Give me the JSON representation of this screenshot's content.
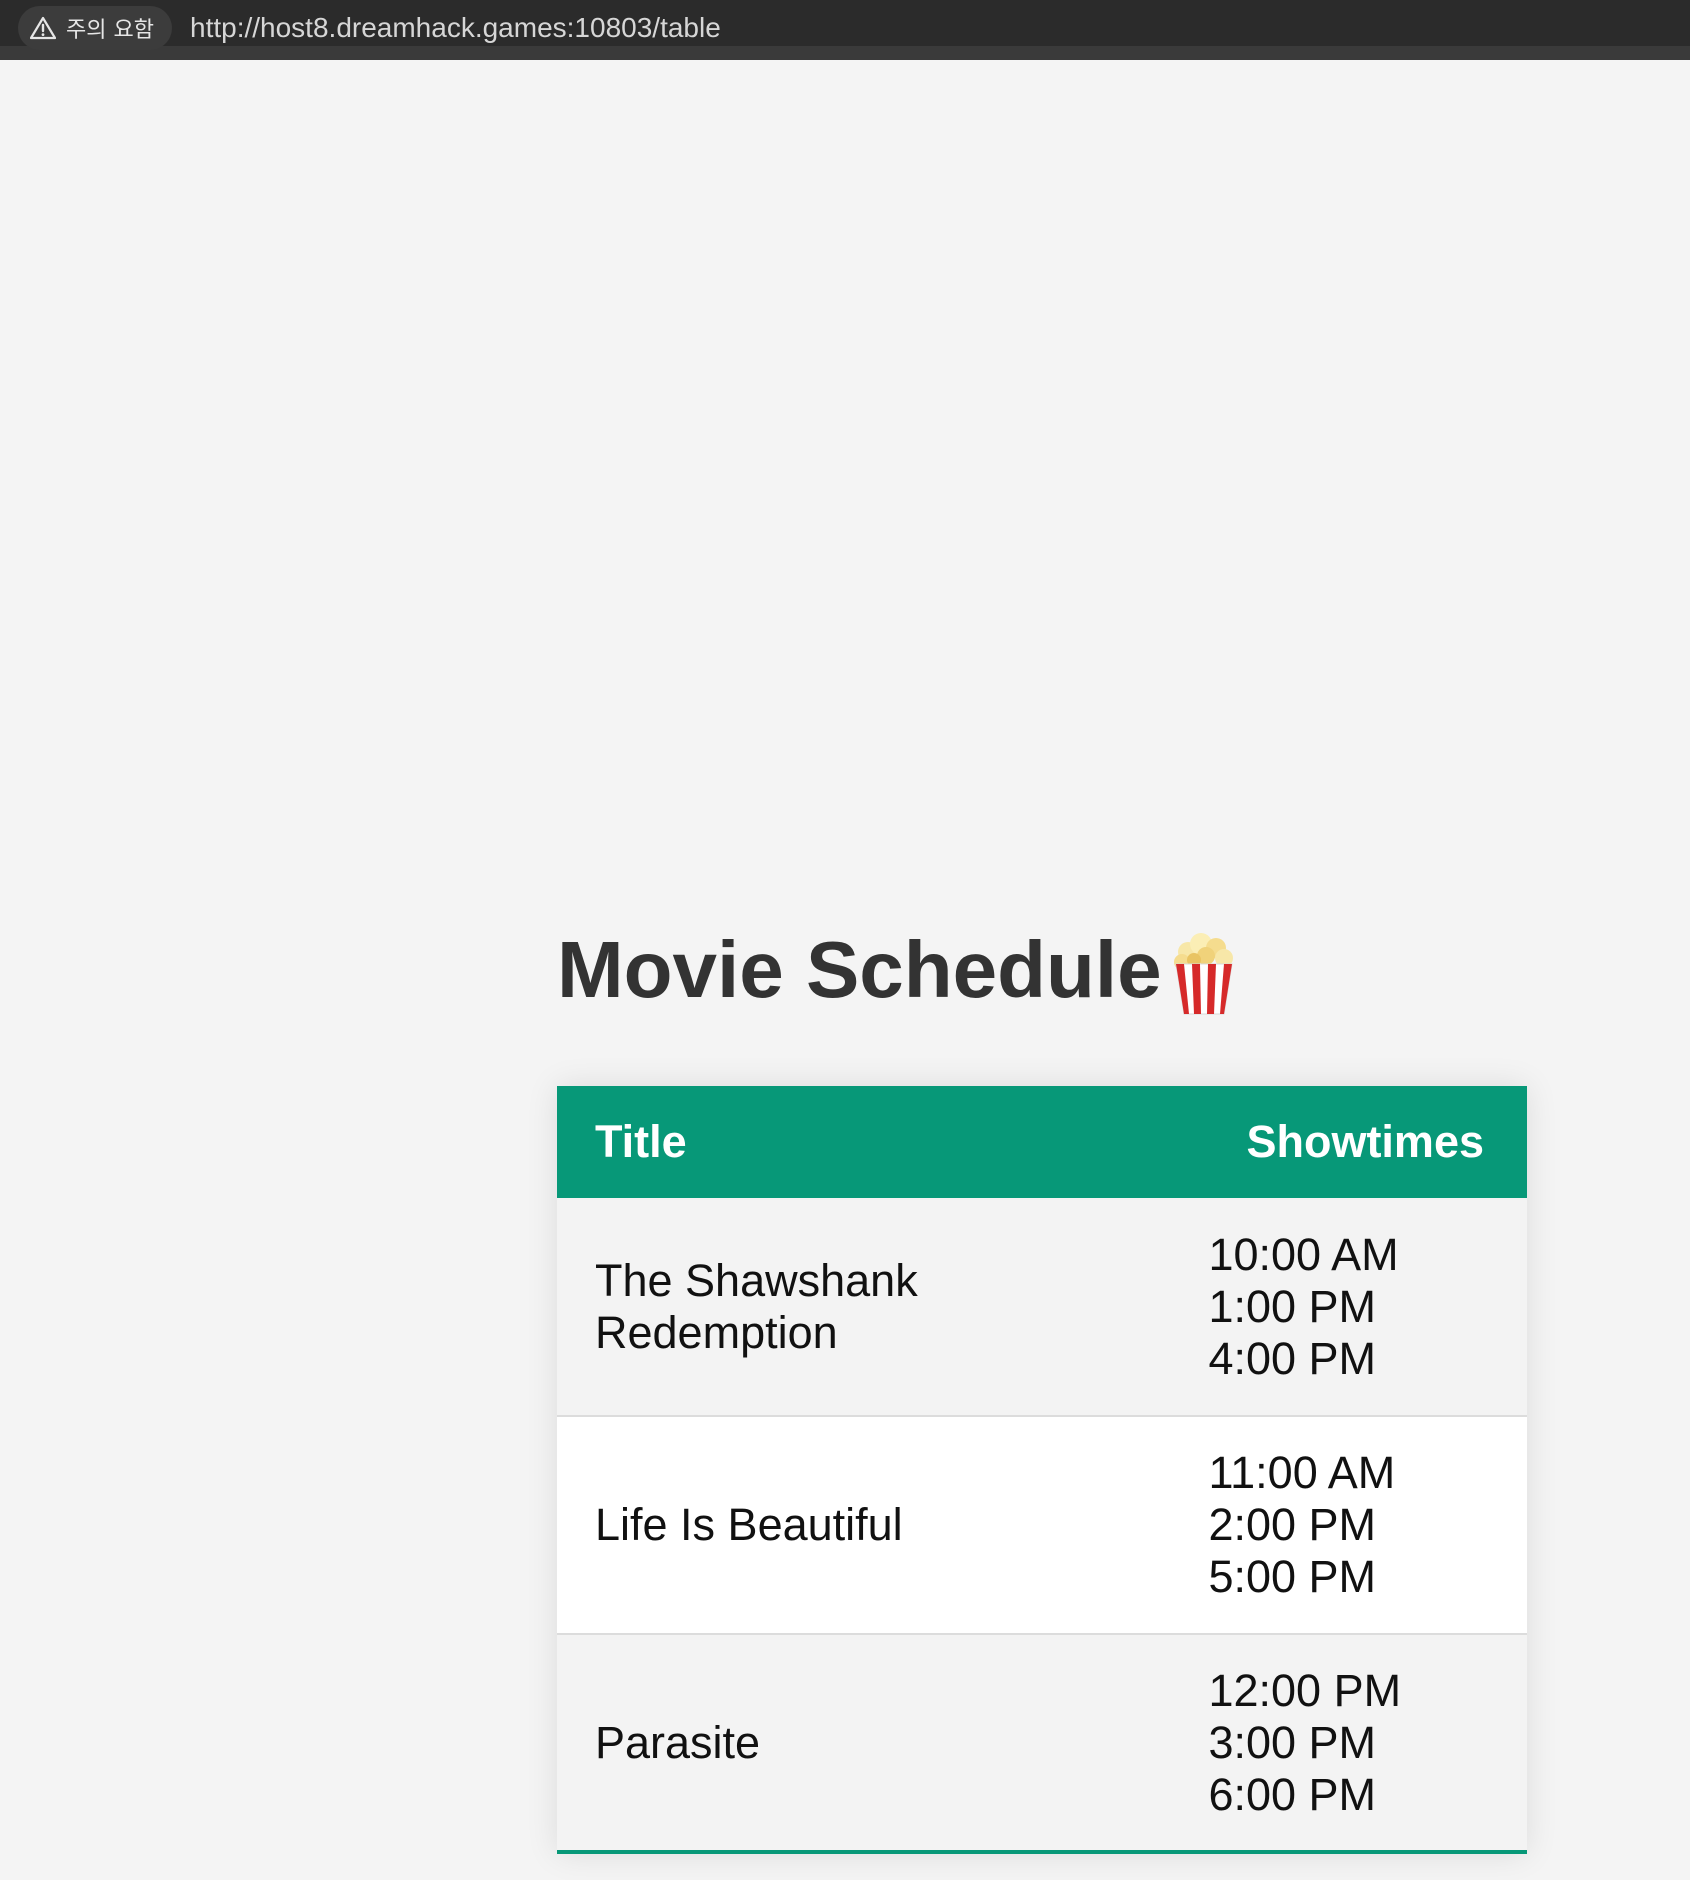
{
  "browser": {
    "security_label": "주의 요함",
    "url": "http://host8.dreamhack.games:10803/table"
  },
  "page": {
    "title": "Movie Schedule",
    "title_icon": "popcorn-icon"
  },
  "table": {
    "headers": {
      "title": "Title",
      "showtimes": "Showtimes"
    },
    "rows": [
      {
        "title": "The Shawshank Redemption",
        "showtimes": [
          "10:00 AM",
          "1:00 PM",
          "4:00 PM"
        ]
      },
      {
        "title": "Life Is Beautiful",
        "showtimes": [
          "11:00 AM",
          "2:00 PM",
          "5:00 PM"
        ]
      },
      {
        "title": "Parasite",
        "showtimes": [
          "12:00 PM",
          "3:00 PM",
          "6:00 PM"
        ]
      }
    ]
  },
  "colors": {
    "accent": "#079878",
    "background": "#f4f4f4",
    "heading": "#333333"
  }
}
